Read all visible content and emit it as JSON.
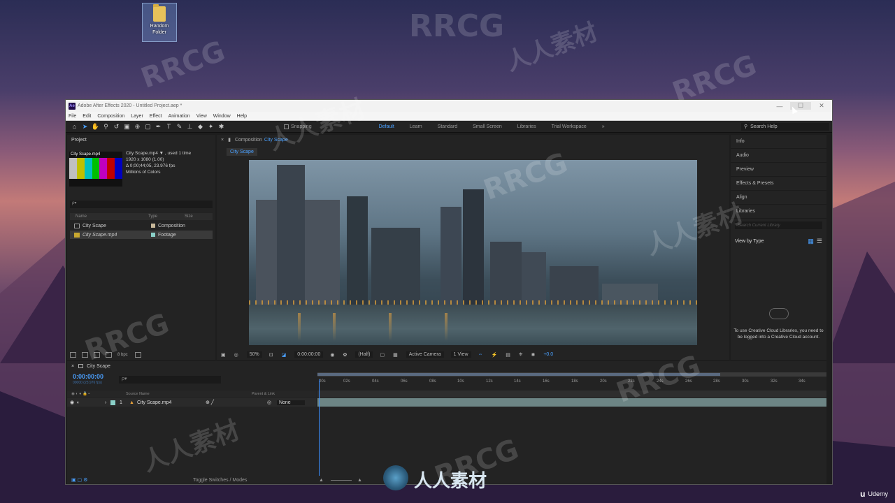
{
  "desktop": {
    "folder_label_1": "Random",
    "folder_label_2": "Folder"
  },
  "window": {
    "title": "Adobe After Effects 2020 - Untitled Project.aep *",
    "logo": "Ae",
    "minimize": "—",
    "maximize": "☐",
    "close": "✕"
  },
  "menu": [
    "File",
    "Edit",
    "Composition",
    "Layer",
    "Effect",
    "Animation",
    "View",
    "Window",
    "Help"
  ],
  "toolbar": {
    "tools": [
      "home-icon",
      "selection-icon",
      "hand-icon",
      "zoom-icon",
      "rotate-icon",
      "camera-icon",
      "pan-behind-icon",
      "rectangle-icon",
      "pen-icon",
      "type-icon",
      "brush-icon",
      "clone-stamp-icon",
      "eraser-icon",
      "roto-brush-icon",
      "puppet-icon"
    ],
    "snapping": "Snapping",
    "workspaces": [
      "Default",
      "Learn",
      "Standard",
      "Small Screen",
      "Libraries",
      "Trial Workspace"
    ],
    "active_workspace": "Default",
    "more": "»",
    "search_placeholder": "Search Help"
  },
  "project": {
    "title": "Project",
    "thumb_name": "City Scape.mp4",
    "meta_name": "City Scape.mp4 ▼ , used 1 time",
    "meta_res": "1920 x 1080 (1.00)",
    "meta_dur": "Δ 0;00;44;05, 23.976 fps",
    "meta_colors": "Millions of Colors",
    "search_icon": "ρ▾",
    "columns": [
      "Name",
      "Type",
      "Size"
    ],
    "items": [
      {
        "name": "City Scape",
        "type": "Composition"
      },
      {
        "name": "City Scape.mp4",
        "type": "Footage"
      }
    ],
    "bpc": "8 bpc"
  },
  "composition": {
    "tab_prefix": "Composition",
    "tab_name": "City Scape",
    "breadcrumb": "City Scape",
    "zoom": "50%",
    "time": "0:00:00:00",
    "resolution": "(Half)",
    "camera": "Active Camera",
    "views": "1 View",
    "exposure": "+0.0"
  },
  "right_panel": {
    "items": [
      "Info",
      "Audio",
      "Preview",
      "Effects & Presets",
      "Align",
      "Libraries"
    ],
    "lib_search": "Search Current Library",
    "view_by": "View by Type",
    "message": "To use Creative Cloud Libraries, you need to be logged into a Creative Cloud account."
  },
  "timeline": {
    "tab": "City Scape",
    "timecode": "0:00:00:00",
    "fps": "00000 (23.976 fps)",
    "search_icon": "ρ▾",
    "ticks": [
      "00s",
      "02s",
      "04s",
      "06s",
      "08s",
      "10s",
      "12s",
      "14s",
      "16s",
      "18s",
      "20s",
      "22s",
      "24s",
      "26s",
      "28s",
      "30s",
      "32s",
      "34s"
    ],
    "col_source": "Source Name",
    "col_parent": "Parent & Link",
    "layer_num": "1",
    "layer_name": "City Scape.mp4",
    "parent": "None",
    "footer": "Toggle Switches / Modes"
  },
  "watermark": {
    "brand": "RRCG",
    "cn": "人人素材",
    "logo_text": "人人素材",
    "udemy": "Udemy"
  }
}
